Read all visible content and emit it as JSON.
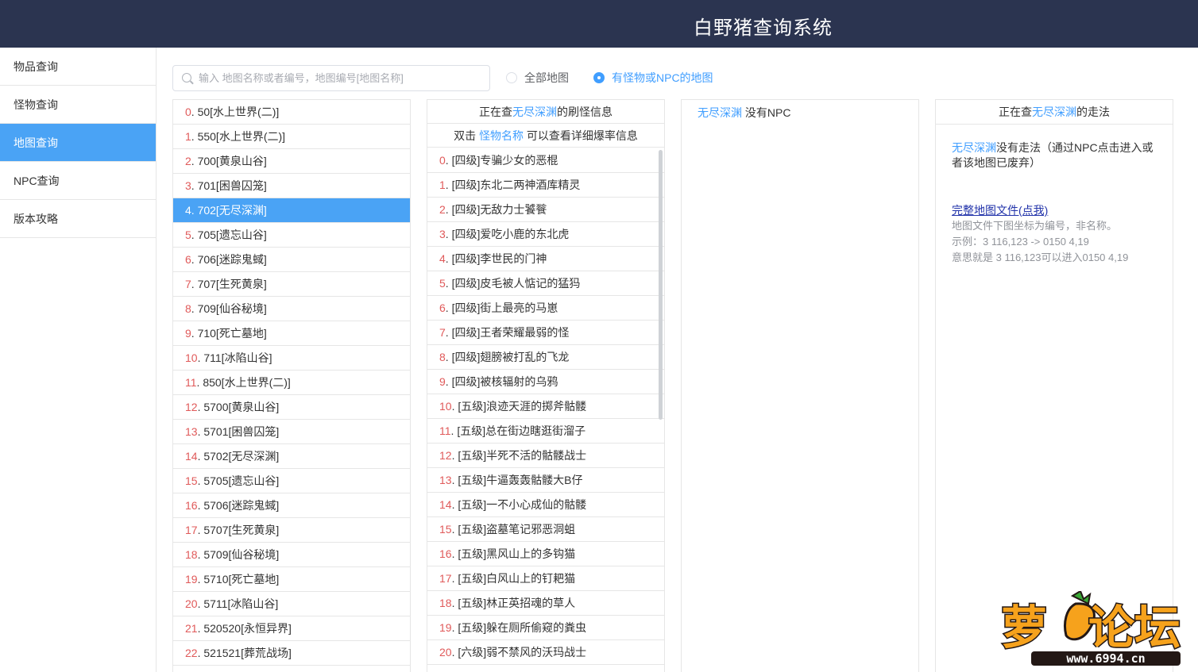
{
  "header": {
    "title": "白野猪查询系统"
  },
  "sidebar": {
    "items": [
      {
        "label": "物品查询",
        "active": false
      },
      {
        "label": "怪物查询",
        "active": false
      },
      {
        "label": "地图查询",
        "active": true
      },
      {
        "label": "NPC查询",
        "active": false
      },
      {
        "label": "版本攻略",
        "active": false
      }
    ]
  },
  "search": {
    "placeholder": "输入 地图名称或者编号，地图编号[地图名称]",
    "value": ""
  },
  "filters": [
    {
      "label": "全部地图",
      "checked": false
    },
    {
      "label": "有怪物或NPC的地图",
      "checked": true
    }
  ],
  "maps": {
    "selected_index": 4,
    "items": [
      {
        "idx": "0",
        "label": "50[水上世界(二)]"
      },
      {
        "idx": "1",
        "label": "550[水上世界(二)]"
      },
      {
        "idx": "2",
        "label": "700[黄泉山谷]"
      },
      {
        "idx": "3",
        "label": "701[困兽囚笼]"
      },
      {
        "idx": "4",
        "label": "702[无尽深渊]"
      },
      {
        "idx": "5",
        "label": "705[遗忘山谷]"
      },
      {
        "idx": "6",
        "label": "706[迷踪鬼蜮]"
      },
      {
        "idx": "7",
        "label": "707[生死黄泉]"
      },
      {
        "idx": "8",
        "label": "709[仙谷秘境]"
      },
      {
        "idx": "9",
        "label": "710[死亡墓地]"
      },
      {
        "idx": "10",
        "label": "711[冰陷山谷]"
      },
      {
        "idx": "11",
        "label": "850[水上世界(二)]"
      },
      {
        "idx": "12",
        "label": "5700[黄泉山谷]"
      },
      {
        "idx": "13",
        "label": "5701[困兽囚笼]"
      },
      {
        "idx": "14",
        "label": "5702[无尽深渊]"
      },
      {
        "idx": "15",
        "label": "5705[遗忘山谷]"
      },
      {
        "idx": "16",
        "label": "5706[迷踪鬼蜮]"
      },
      {
        "idx": "17",
        "label": "5707[生死黄泉]"
      },
      {
        "idx": "18",
        "label": "5709[仙谷秘境]"
      },
      {
        "idx": "19",
        "label": "5710[死亡墓地]"
      },
      {
        "idx": "20",
        "label": "5711[冰陷山谷]"
      },
      {
        "idx": "21",
        "label": "520520[永恒异界]"
      },
      {
        "idx": "22",
        "label": "521521[葬荒战场]"
      }
    ]
  },
  "monsters": {
    "header_prefix": "正在查",
    "header_map": "无尽深渊",
    "header_suffix": "的刷怪信息",
    "hint_prefix": "双击 ",
    "hint_link": "怪物名称",
    "hint_suffix": " 可以查看详细爆率信息",
    "items": [
      {
        "idx": "0",
        "label": "[四级]专骗少女的恶棍"
      },
      {
        "idx": "1",
        "label": "[四级]东北二两神酒库精灵"
      },
      {
        "idx": "2",
        "label": "[四级]无敌力士饕餮"
      },
      {
        "idx": "3",
        "label": "[四级]爱吃小鹿的东北虎"
      },
      {
        "idx": "4",
        "label": "[四级]李世民的门神"
      },
      {
        "idx": "5",
        "label": "[四级]皮毛被人惦记的猛犸"
      },
      {
        "idx": "6",
        "label": "[四级]街上最亮的马崽"
      },
      {
        "idx": "7",
        "label": "[四级]王者荣耀最弱的怪"
      },
      {
        "idx": "8",
        "label": "[四级]翅膀被打乱的飞龙"
      },
      {
        "idx": "9",
        "label": "[四级]被核辐射的乌鸦"
      },
      {
        "idx": "10",
        "label": "[五级]浪迹天涯的掷斧骷髅"
      },
      {
        "idx": "11",
        "label": "[五级]总在街边瞎逛街溜子"
      },
      {
        "idx": "12",
        "label": "[五级]半死不活的骷髅战士"
      },
      {
        "idx": "13",
        "label": "[五级]牛逼轰轰骷髅大B仔"
      },
      {
        "idx": "14",
        "label": "[五级]一不小心成仙的骷髅"
      },
      {
        "idx": "15",
        "label": "[五级]盗墓笔记邪恶洞蛆"
      },
      {
        "idx": "16",
        "label": "[五级]黑风山上的多钩猫"
      },
      {
        "idx": "17",
        "label": "[五级]白风山上的钉耙猫"
      },
      {
        "idx": "18",
        "label": "[五级]林正英招魂的草人"
      },
      {
        "idx": "19",
        "label": "[五级]躲在厕所偷窥的粪虫"
      },
      {
        "idx": "20",
        "label": "[六级]弱不禁风的沃玛战士"
      }
    ]
  },
  "npc": {
    "map_name": "无尽深渊",
    "text": " 没有NPC"
  },
  "walk": {
    "header_prefix": "正在查",
    "header_map": "无尽深渊",
    "header_suffix": "的走法",
    "no_walk_map": "无尽深渊",
    "no_walk_text": "没有走法（通过NPC点击进入或者该地图已废弃）",
    "link": "完整地图文件(点我)",
    "notes": [
      "地图文件下图坐标为编号，非名称。",
      "示例：3 116,123 -> 0150 4,19",
      "意思就是 3 116,123可以进入0150 4,19"
    ]
  },
  "watermark": {
    "text": "萝卜论坛",
    "url": "www.6994.cn",
    "colors": {
      "orange": "#f6a21c",
      "dark": "#231815"
    }
  }
}
